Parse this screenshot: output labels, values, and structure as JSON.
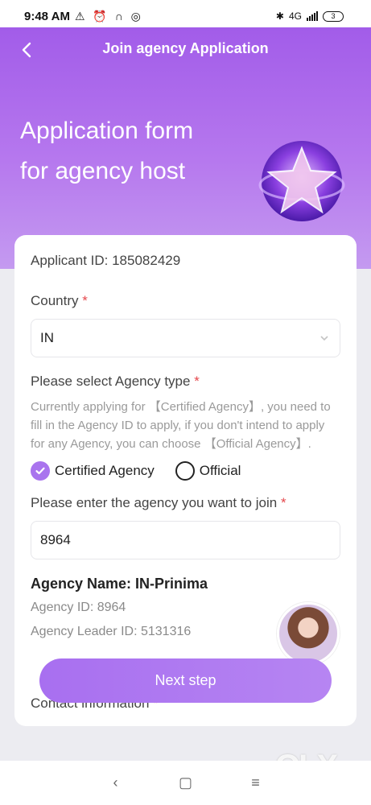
{
  "status_bar": {
    "time": "9:48 AM",
    "left_icons": "⚠ ⏰ ∩ ◎",
    "network": "4G",
    "battery": "3"
  },
  "nav": {
    "title": "Join agency Application"
  },
  "hero": {
    "line1": "Application form",
    "line2": "for agency host"
  },
  "form": {
    "applicant_id": "Applicant ID: 185082429",
    "country_label": "Country",
    "country_value": "IN",
    "agency_type_label": "Please select Agency type",
    "agency_type_hint": "Currently applying for 【Certified Agency】, you need to fill in the Agency ID to apply, if you don't intend to apply for any Agency, you can choose 【Official Agency】.",
    "option_certified": "Certified Agency",
    "option_official": "Official",
    "selected_option": "Certified Agency",
    "agency_input_label": "Please enter the agency you want to join",
    "agency_input_value": "8964",
    "agency_name": "Agency Name: IN-Prinima",
    "agency_id": "Agency ID: 8964",
    "agency_leader": "Agency Leader ID: 5131316",
    "contact_label": "Contact information",
    "required_mark": "*"
  },
  "next_button": "Next step",
  "watermark": "OLX",
  "colors": {
    "accent": "#a974ee",
    "required": "#e5484d"
  }
}
